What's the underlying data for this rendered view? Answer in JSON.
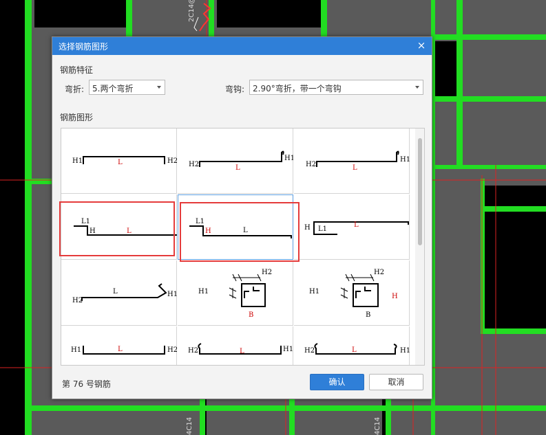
{
  "dialog": {
    "title": "选择钢筋图形",
    "close_icon": "×",
    "section_feature": "钢筋特征",
    "bend_label": "弯折:",
    "bend_value": "5.两个弯折",
    "hook_label": "弯钩:",
    "hook_value": "2.90°弯折，带一个弯钩",
    "section_shape": "钢筋图形",
    "status": "第 76 号钢筋",
    "ok_label": "确认",
    "cancel_label": "取消"
  },
  "background": {
    "rebar_label_top": "2C14@",
    "rebar_label_bottom_left": "4C14",
    "rebar_label_bottom_right": "4C14"
  },
  "shapes": [
    {
      "H1": "H1",
      "L": "L",
      "H2": "H2"
    },
    {
      "H2": "H2",
      "L": "L",
      "H1": "H1"
    },
    {
      "H2": "H2",
      "L": "L",
      "H1": "H1"
    },
    {
      "L1": "L1",
      "H": "H",
      "L": "L"
    },
    {
      "L1": "L1",
      "H": "H",
      "L": "L"
    },
    {
      "H": "H",
      "L1": "L1",
      "L": "L"
    },
    {
      "L": "L",
      "H2": "H2",
      "H1": "H1"
    },
    {
      "H1": "H1",
      "H2": "H2",
      "B": "B"
    },
    {
      "H1": "H1",
      "H2": "H2",
      "H": "H",
      "B": "B"
    },
    {
      "H1": "H1",
      "L": "L",
      "H2": "H2"
    },
    {
      "H2": "H2",
      "L": "L",
      "H1": "H1"
    },
    {
      "H2": "H2",
      "L": "L",
      "H1": "H1"
    }
  ],
  "colors": {
    "accent": "#2f7fd8",
    "highlight": "#e53b3b",
    "cad_green": "#22dd22",
    "cad_red": "#dd2222",
    "dim_red": "#cc0000"
  }
}
